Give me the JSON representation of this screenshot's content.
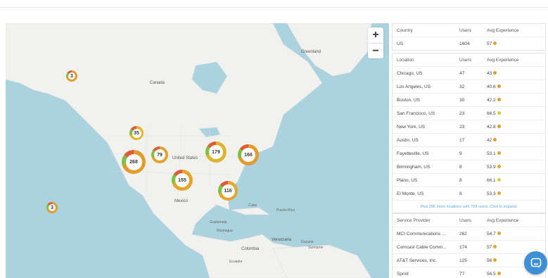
{
  "map": {
    "zoom_in_label": "+",
    "zoom_out_label": "−",
    "labels": {
      "greenland": "Greenland",
      "canada": "Canada",
      "united_states": "United States",
      "mexico": "Mexico",
      "venezuela": "Venezuela",
      "colombia": "Colombia",
      "cuba": "Cuba",
      "puerto_rico": "Puerto Rico",
      "guatemala": "Guatemala",
      "nicaragua": "Nicaragua",
      "suriname": "Suriname",
      "guyana": "Guyana",
      "ecuador": "Ecuador"
    },
    "clusters": [
      {
        "label": "3",
        "color": "#e39b2b"
      },
      {
        "label": "35",
        "color": "#e3b62b"
      },
      {
        "label": "79",
        "color": "#e3a22b"
      },
      {
        "label": "268",
        "color": "#e39b2b"
      },
      {
        "label": "179",
        "color": "#dcb52c"
      },
      {
        "label": "166",
        "color": "#e39b2b"
      },
      {
        "label": "155",
        "color": "#e3a62b"
      },
      {
        "label": "116",
        "color": "#e3a62b"
      },
      {
        "label": "3",
        "color": "#e39b2b"
      }
    ]
  },
  "country_table": {
    "headers": [
      "Country",
      "Users",
      "Avg Experience"
    ],
    "rows": [
      {
        "name": "US",
        "users": "1604",
        "exp": "57",
        "dot": "#e3a62b"
      }
    ]
  },
  "location_table": {
    "headers": [
      "Location",
      "Users",
      "Avg Experience"
    ],
    "rows": [
      {
        "name": "Chicago, US",
        "users": "47",
        "exp": "43",
        "dot": "#e39b2b"
      },
      {
        "name": "Los Angeles, US",
        "users": "32",
        "exp": "40.6",
        "dot": "#e39b2b"
      },
      {
        "name": "Boston, US",
        "users": "30",
        "exp": "42.2",
        "dot": "#e39b2b"
      },
      {
        "name": "San Francisco, US",
        "users": "23",
        "exp": "66.5",
        "dot": "#cfd23a"
      },
      {
        "name": "New York, US",
        "users": "23",
        "exp": "42.8",
        "dot": "#e39b2b"
      },
      {
        "name": "Austin, US",
        "users": "17",
        "exp": "42",
        "dot": "#e39b2b"
      },
      {
        "name": "Fayetteville, US",
        "users": "9",
        "exp": "53.1",
        "dot": "#e3a62b"
      },
      {
        "name": "Birmingham, US",
        "users": "8",
        "exp": "53.9",
        "dot": "#e3a62b"
      },
      {
        "name": "Plano, US",
        "users": "8",
        "exp": "66.1",
        "dot": "#cfd23a"
      },
      {
        "name": "El Monte, US",
        "users": "8",
        "exp": "53.3",
        "dot": "#e3a62b"
      }
    ],
    "expand_text": "Plus 280 more locations with 799 users. Click to expand."
  },
  "provider_table": {
    "headers": [
      "Service Provider",
      "Users",
      "Avg Experience"
    ],
    "rows": [
      {
        "name": "MCI Communications ...",
        "users": "262",
        "exp": "54.7",
        "dot": "#e3a62b"
      },
      {
        "name": "Comcast Cable Comm...",
        "users": "174",
        "exp": "57",
        "dot": "#e3a62b"
      },
      {
        "name": "AT&T Services, Inc.",
        "users": "125",
        "exp": "56",
        "dot": "#e3a62b"
      },
      {
        "name": "Sprint",
        "users": "77",
        "exp": "56.5",
        "dot": "#e3a62b"
      }
    ]
  },
  "chat": {
    "icon": "chat-bubble-icon"
  }
}
